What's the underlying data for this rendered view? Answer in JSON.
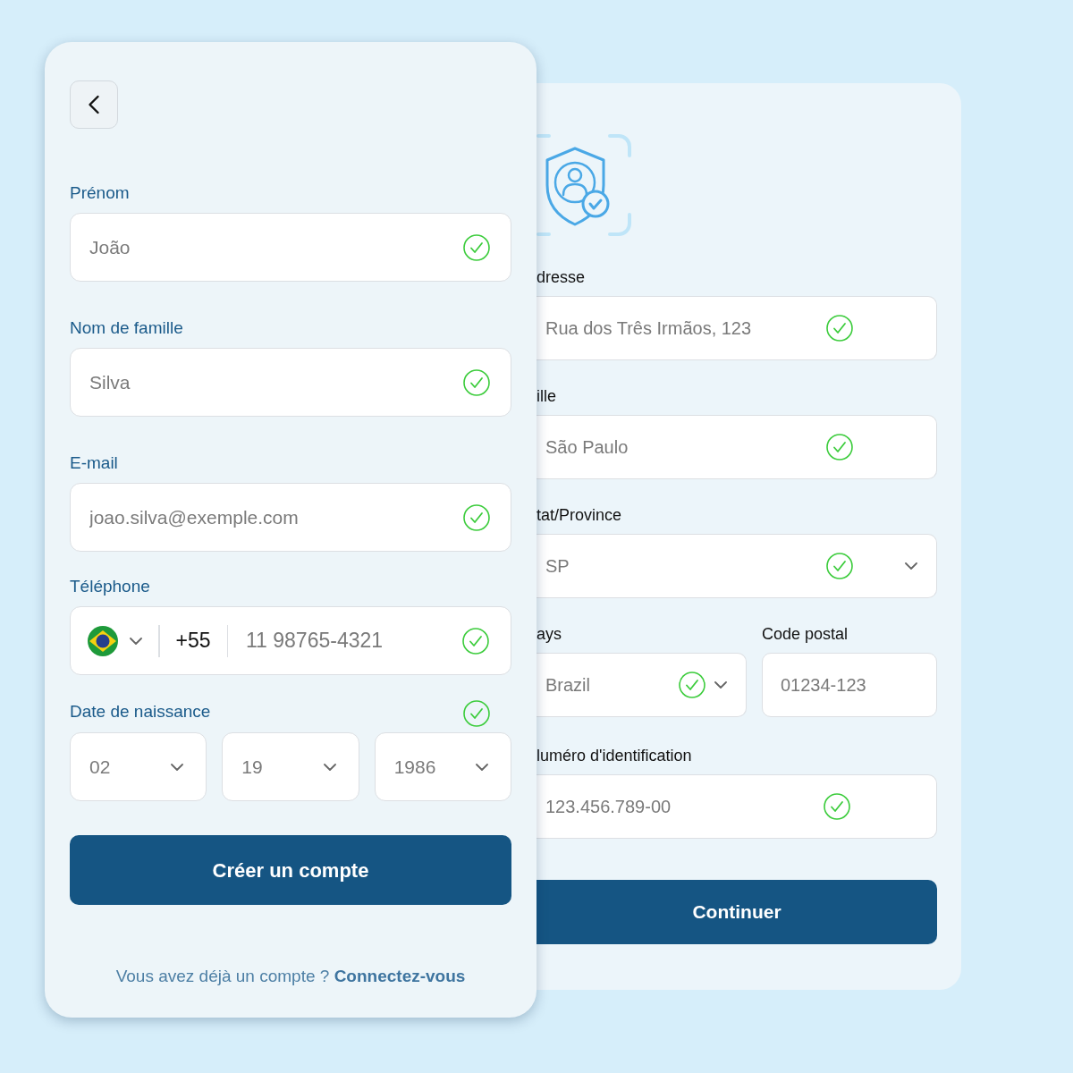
{
  "signup_form": {
    "fields": [
      {
        "kind": "text",
        "label": "Prénom",
        "value": "João",
        "valid": true
      },
      {
        "kind": "text",
        "label": "Nom de famille",
        "value": "Silva",
        "valid": true
      },
      {
        "kind": "text",
        "label": "E-mail",
        "value": "joao.silva@exemple.com",
        "valid": true
      },
      {
        "kind": "phone",
        "label": "Téléphone",
        "country_code": "+55",
        "value": "11 98765-4321",
        "valid": true
      },
      {
        "kind": "date",
        "label": "Date de naissance",
        "parts": [
          "02",
          "19",
          "1986"
        ],
        "valid": true
      }
    ],
    "submit": "Créer un compte",
    "footer": {
      "text": "Vous avez déjà un compte ?",
      "link": "Connectez-vous"
    }
  },
  "address_form": {
    "fields": [
      {
        "kind": "text",
        "label": "dresse",
        "value": "Rua dos Três Irmãos, 123",
        "valid": true
      },
      {
        "kind": "text",
        "label": "ille",
        "value": "São Paulo",
        "valid": true
      },
      {
        "kind": "select",
        "label": "tat/Province",
        "value": "SP",
        "valid": true
      },
      {
        "kind": "pair",
        "items": [
          {
            "kind": "select",
            "label": "ays",
            "value": "Brazil",
            "valid": true
          },
          {
            "kind": "text",
            "label": "Code postal",
            "value": "01234-123",
            "valid": false
          }
        ]
      },
      {
        "kind": "text",
        "label": "luméro d'identification",
        "value": "123.456.789-00",
        "valid": true
      }
    ],
    "submit": "Continuer"
  }
}
